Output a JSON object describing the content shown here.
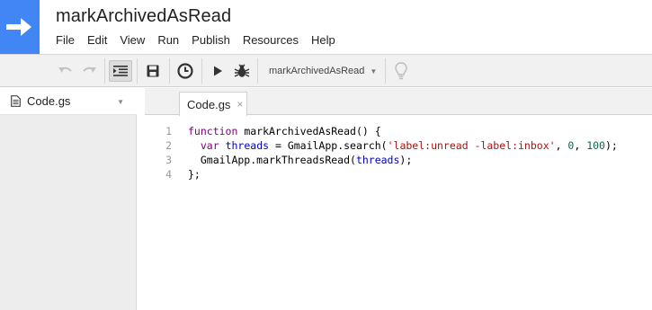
{
  "app": {
    "title": "markArchivedAsRead"
  },
  "menu": [
    "File",
    "Edit",
    "View",
    "Run",
    "Publish",
    "Resources",
    "Help"
  ],
  "toolbar": {
    "function_select": "markArchivedAsRead",
    "icons": [
      "undo-icon",
      "redo-icon",
      "indent-icon",
      "save-icon",
      "clock-icon",
      "run-icon",
      "debug-bug-icon",
      "lightbulb-icon"
    ]
  },
  "sidebar": {
    "files": [
      {
        "name": "Code.gs"
      }
    ]
  },
  "editor": {
    "tab": {
      "label": "Code.gs",
      "close": "×"
    },
    "line_numbers": [
      "1",
      "2",
      "3",
      "4"
    ],
    "lines": [
      [
        {
          "t": "function",
          "c": "kw"
        },
        {
          "t": " markArchivedAsRead() {",
          "c": ""
        }
      ],
      [
        {
          "t": "  ",
          "c": ""
        },
        {
          "t": "var",
          "c": "kw"
        },
        {
          "t": " ",
          "c": ""
        },
        {
          "t": "threads",
          "c": "var"
        },
        {
          "t": " = GmailApp.search(",
          "c": ""
        },
        {
          "t": "'label:unread -label:inbox'",
          "c": "str"
        },
        {
          "t": ", ",
          "c": ""
        },
        {
          "t": "0",
          "c": "num"
        },
        {
          "t": ", ",
          "c": ""
        },
        {
          "t": "100",
          "c": "num"
        },
        {
          "t": ");",
          "c": ""
        }
      ],
      [
        {
          "t": "  GmailApp.markThreadsRead(",
          "c": ""
        },
        {
          "t": "threads",
          "c": "var"
        },
        {
          "t": ");",
          "c": ""
        }
      ],
      [
        {
          "t": "};",
          "c": ""
        }
      ]
    ]
  },
  "colors": {
    "brand": "#4285f4",
    "keyword": "#800080",
    "variable": "#0000c0",
    "string": "#aa1111",
    "number": "#116644"
  }
}
